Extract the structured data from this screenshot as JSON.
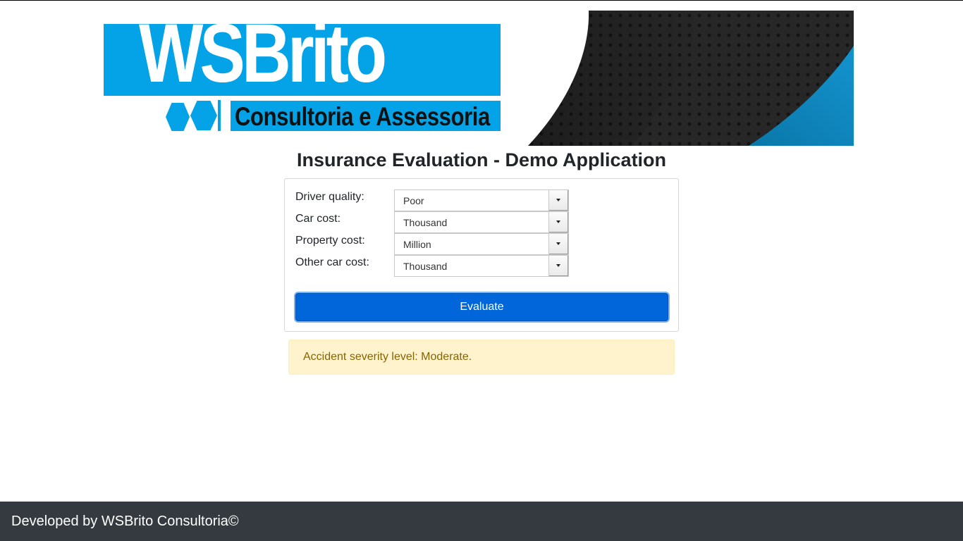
{
  "banner": {
    "logo_word": "WSBrito",
    "logo_subtitle": "Consultoria e Assessoria",
    "brand_color": "#04a3e8",
    "dark_color": "#232323"
  },
  "page": {
    "title": "Insurance Evaluation - Demo Application"
  },
  "form": {
    "fields": [
      {
        "label": "Driver quality:",
        "value": "Poor"
      },
      {
        "label": "Car cost:",
        "value": "Thousand"
      },
      {
        "label": "Property cost:",
        "value": "Million"
      },
      {
        "label": "Other car cost:",
        "value": "Thousand"
      }
    ],
    "submit_label": "Evaluate",
    "button_color": "#0066d9"
  },
  "result": {
    "message": "Accident severity level: Moderate.",
    "alert_color": "#fff3cd"
  },
  "footer": {
    "text": "Developed by WSBrito Consultoria©"
  }
}
